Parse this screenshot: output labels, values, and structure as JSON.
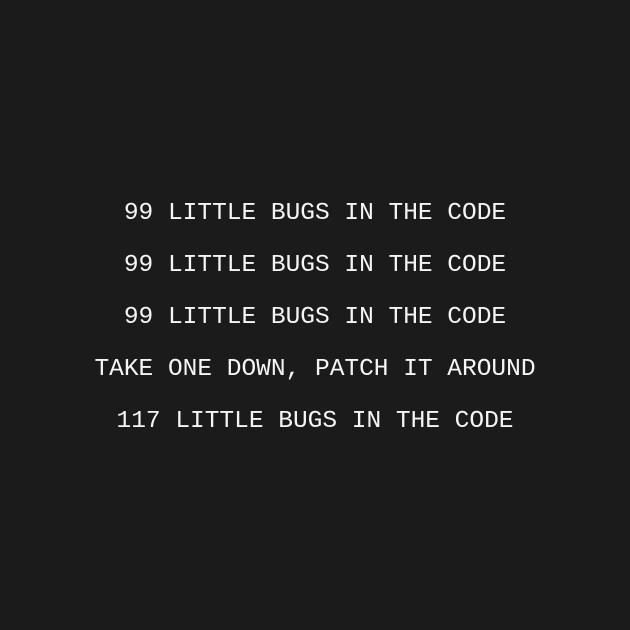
{
  "lines": [
    "99 LITTLE BUGS IN THE CODE",
    "99 LITTLE BUGS IN THE CODE",
    "99 LITTLE BUGS IN THE CODE",
    "TAKE ONE DOWN, PATCH IT AROUND",
    "117 LITTLE BUGS IN THE CODE"
  ],
  "colors": {
    "background": "#1b1b1b",
    "text": "#f5f5f5"
  }
}
